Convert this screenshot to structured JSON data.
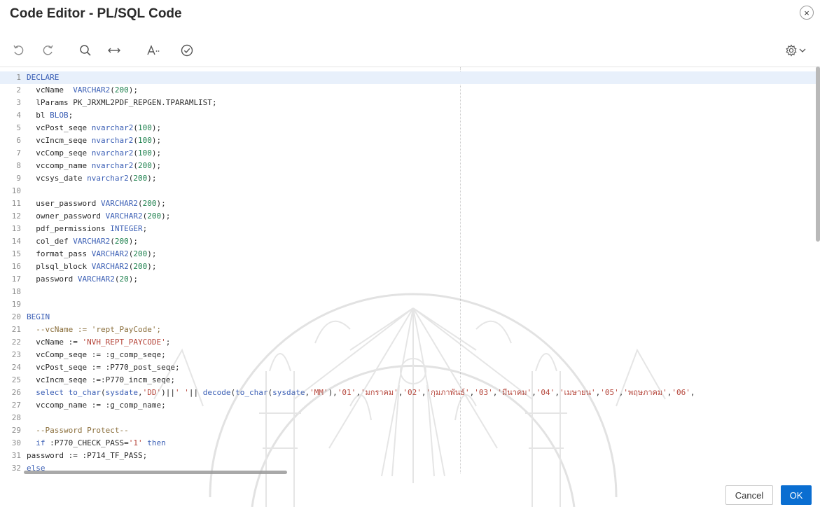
{
  "dialog": {
    "title": "Code Editor - PL/SQL Code",
    "close_glyph": "×"
  },
  "toolbar": {
    "icons": [
      "undo-icon",
      "redo-icon",
      "search-icon",
      "replace-icon",
      "autocomplete-icon",
      "validate-icon",
      "gear-icon",
      "chevron-down-icon"
    ]
  },
  "editor": {
    "active_line": 1,
    "lines": [
      {
        "n": "1",
        "text": "DECLARE"
      },
      {
        "n": "2",
        "text": "  vcName  VARCHAR2(200);"
      },
      {
        "n": "3",
        "text": "  lParams PK_JRXML2PDF_REPGEN.TPARAMLIST;"
      },
      {
        "n": "4",
        "text": "  bl BLOB;"
      },
      {
        "n": "5",
        "text": "  vcPost_seqe nvarchar2(100);"
      },
      {
        "n": "6",
        "text": "  vcIncm_seqe nvarchar2(100);"
      },
      {
        "n": "7",
        "text": "  vcComp_seqe nvarchar2(100);"
      },
      {
        "n": "8",
        "text": "  vccomp_name nvarchar2(200);"
      },
      {
        "n": "9",
        "text": "  vcsys_date nvarchar2(200);"
      },
      {
        "n": "10",
        "text": ""
      },
      {
        "n": "11",
        "text": "  user_password VARCHAR2(200);"
      },
      {
        "n": "12",
        "text": "  owner_password VARCHAR2(200);"
      },
      {
        "n": "13",
        "text": "  pdf_permissions INTEGER;"
      },
      {
        "n": "14",
        "text": "  col_def VARCHAR2(200);"
      },
      {
        "n": "15",
        "text": "  format_pass VARCHAR2(200);"
      },
      {
        "n": "16",
        "text": "  plsql_block VARCHAR2(200);"
      },
      {
        "n": "17",
        "text": "  password VARCHAR2(20);"
      },
      {
        "n": "18",
        "text": ""
      },
      {
        "n": "19",
        "text": ""
      },
      {
        "n": "20",
        "text": "BEGIN"
      },
      {
        "n": "21",
        "text": "  --vcName := 'rept_PayCode';"
      },
      {
        "n": "22",
        "text": "  vcName := 'NVH_REPT_PAYCODE';"
      },
      {
        "n": "23",
        "text": "  vcComp_seqe := :g_comp_seqe;"
      },
      {
        "n": "24",
        "text": "  vcPost_seqe := :P770_post_seqe;"
      },
      {
        "n": "25",
        "text": "  vcIncm_seqe :=:P770_incm_seqe;"
      },
      {
        "n": "26",
        "text": "  select to_char(sysdate,'DD')||' '|| decode(to_char(sysdate,'MM'),'01','มกราคม','02','กุมภาพันธ์','03','มีนาคม','04','เมษายน','05','พฤษภาคม','06','"
      },
      {
        "n": "27",
        "text": "  vccomp_name := :g_comp_name;"
      },
      {
        "n": "28",
        "text": ""
      },
      {
        "n": "29",
        "text": "  --Password Protect--"
      },
      {
        "n": "30",
        "text": "  if :P770_CHECK_PASS='1' then"
      },
      {
        "n": "31",
        "text": "password := :P714_TF_PASS;"
      },
      {
        "n": "32",
        "text": "else"
      }
    ]
  },
  "footer": {
    "cancel_label": "Cancel",
    "ok_label": "OK"
  },
  "colors": {
    "keyword": "#3b5fb5",
    "number": "#1a7f4b",
    "string": "#b5453a",
    "comment": "#8a6e3b",
    "primary_button": "#0a6ed1"
  }
}
